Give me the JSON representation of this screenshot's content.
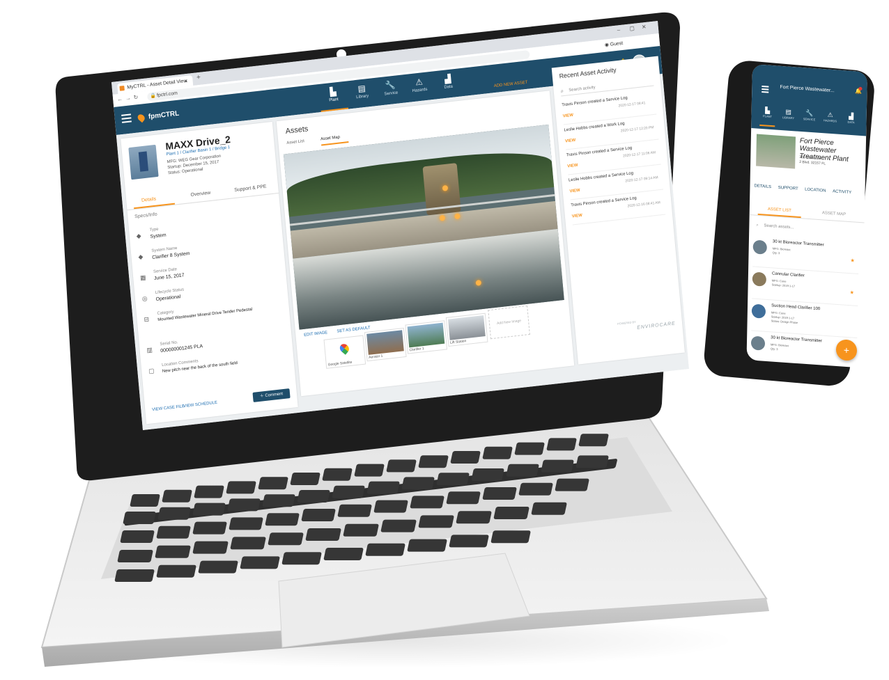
{
  "browser": {
    "tab_title": "MyCTRL - Asset Detail View",
    "tab_close": "×",
    "new_tab": "+",
    "address": "fpctrl.com",
    "profile": "Guest",
    "window_controls": [
      "–",
      "▢",
      "✕"
    ]
  },
  "app": {
    "logo_text": "fpmCTRL",
    "nav": [
      {
        "label": "Plant",
        "icon": "factory-icon",
        "glyph": "▙"
      },
      {
        "label": "Library",
        "icon": "library-icon",
        "glyph": "▤"
      },
      {
        "label": "Service",
        "icon": "wrench-icon",
        "glyph": "🔧"
      },
      {
        "label": "Hazards",
        "icon": "warning-icon",
        "glyph": "⚠"
      },
      {
        "label": "Data",
        "icon": "chart-icon",
        "glyph": "▟"
      }
    ],
    "add_asset": "ADD NEW ASSET"
  },
  "asset": {
    "title": "MAXX Drive_2",
    "subtitle": "Plant 1 / Clarifier Basin 1 / Bridge 1",
    "meta": [
      "MFG: WEG Gear Corporation",
      "Startup: December 15, 2017",
      "Status: Operational"
    ],
    "tabs": [
      "Details",
      "Overview",
      "Support & PPE"
    ],
    "section_label": "Specs/Info",
    "fields": [
      {
        "label": "Type",
        "value": "System",
        "icon": "tag-icon",
        "glyph": "◆"
      },
      {
        "label": "System Name",
        "value": "Clarifier 8 System",
        "icon": "tag-icon",
        "glyph": "◆"
      },
      {
        "label": "Service Date",
        "value": "June 15, 2017",
        "icon": "calendar-icon",
        "glyph": "▦"
      },
      {
        "label": "Lifecycle Status",
        "value": "Operational",
        "icon": "status-icon",
        "glyph": "◎"
      },
      {
        "label": "Category",
        "value": "Mounted Wastewater Mineral Drive Tender Pedestal",
        "icon": "category-icon",
        "glyph": "⊟"
      },
      {
        "label": "Serial No.",
        "value": "000000001245 PLA",
        "icon": "barcode-icon",
        "glyph": "▥"
      },
      {
        "label": "Location Comments",
        "value": "New pitch near the back of the south field",
        "icon": "comment-icon",
        "glyph": "▢"
      }
    ],
    "footer_links": [
      "VIEW CASE FILE",
      "VIEW SCHEDULE"
    ],
    "comment_button": "Comment"
  },
  "assets_panel": {
    "title": "Assets",
    "tabs": [
      "Asset List",
      "Asset Map"
    ],
    "photo_links": [
      "EDIT IMAGE",
      "SET AS DEFAULT"
    ],
    "thumbs": [
      {
        "caption": "Google Satellite"
      },
      {
        "caption": "Aerator 1"
      },
      {
        "caption": "Clarifier 1"
      },
      {
        "caption": "Lift Station"
      }
    ],
    "add_image": "Add New Image"
  },
  "activity": {
    "title": "Recent Asset Activity",
    "search_placeholder": "Search activity",
    "items": [
      {
        "text": "Travis Pinson created a Service Log",
        "date": "2020-12-17 08:41",
        "action": "VIEW"
      },
      {
        "text": "Leslie Hobbs created a Work Log",
        "date": "2020-12-17 12:20 PM",
        "action": "VIEW"
      },
      {
        "text": "Travis Pinson created a Service Log",
        "date": "2020-12-17 11:06 AM",
        "action": "VIEW"
      },
      {
        "text": "Leslie Hobbs created a Service Log",
        "date": "2020-12-17 09:14 AM",
        "action": "VIEW"
      },
      {
        "text": "Travis Pinson created a Service Log",
        "date": "2020-12-16 08:41 AM",
        "action": "VIEW"
      }
    ],
    "brand": "ENVIROCARE",
    "brand_sub": "POWERED BY"
  },
  "phone": {
    "title": "Fort Pierce Wastewater...",
    "nav": [
      {
        "label": "PLANT",
        "glyph": "▙"
      },
      {
        "label": "LIBRARY",
        "glyph": "▤"
      },
      {
        "label": "SERVICE",
        "glyph": "🔧"
      },
      {
        "label": "HAZARDS",
        "glyph": "⚠"
      },
      {
        "label": "DATA",
        "glyph": "▟"
      }
    ],
    "plant_title": "Fort Pierce Wastewater Treatment Plant",
    "plant_meta": [
      "321-555-1234",
      "2 Blvd. 32157 FL"
    ],
    "tabs": [
      "DETAILS",
      "SUPPORT",
      "LOCATION",
      "ACTIVITY"
    ],
    "subtabs": [
      "ASSET LIST",
      "ASSET MAP"
    ],
    "search_placeholder": "Search assets...",
    "items": [
      {
        "name": "30 kt Bioreactor Transmitter",
        "meta": [
          "MFG: Bioreact",
          "Qty: 3"
        ]
      },
      {
        "name": "Cannular Clarifier",
        "meta": [
          "MFG: Cone",
          "Startup: 2019-1-17"
        ]
      },
      {
        "name": "Suction Head Clarifier 100",
        "meta": [
          "MFG: Cone",
          "Startup: 2019-1-17",
          "Status: Design Phase"
        ]
      },
      {
        "name": "30 kt Bioreactor Transmitter",
        "meta": [
          "MFG: Bioreact",
          "Qty: 3"
        ]
      }
    ],
    "fab": "+"
  }
}
